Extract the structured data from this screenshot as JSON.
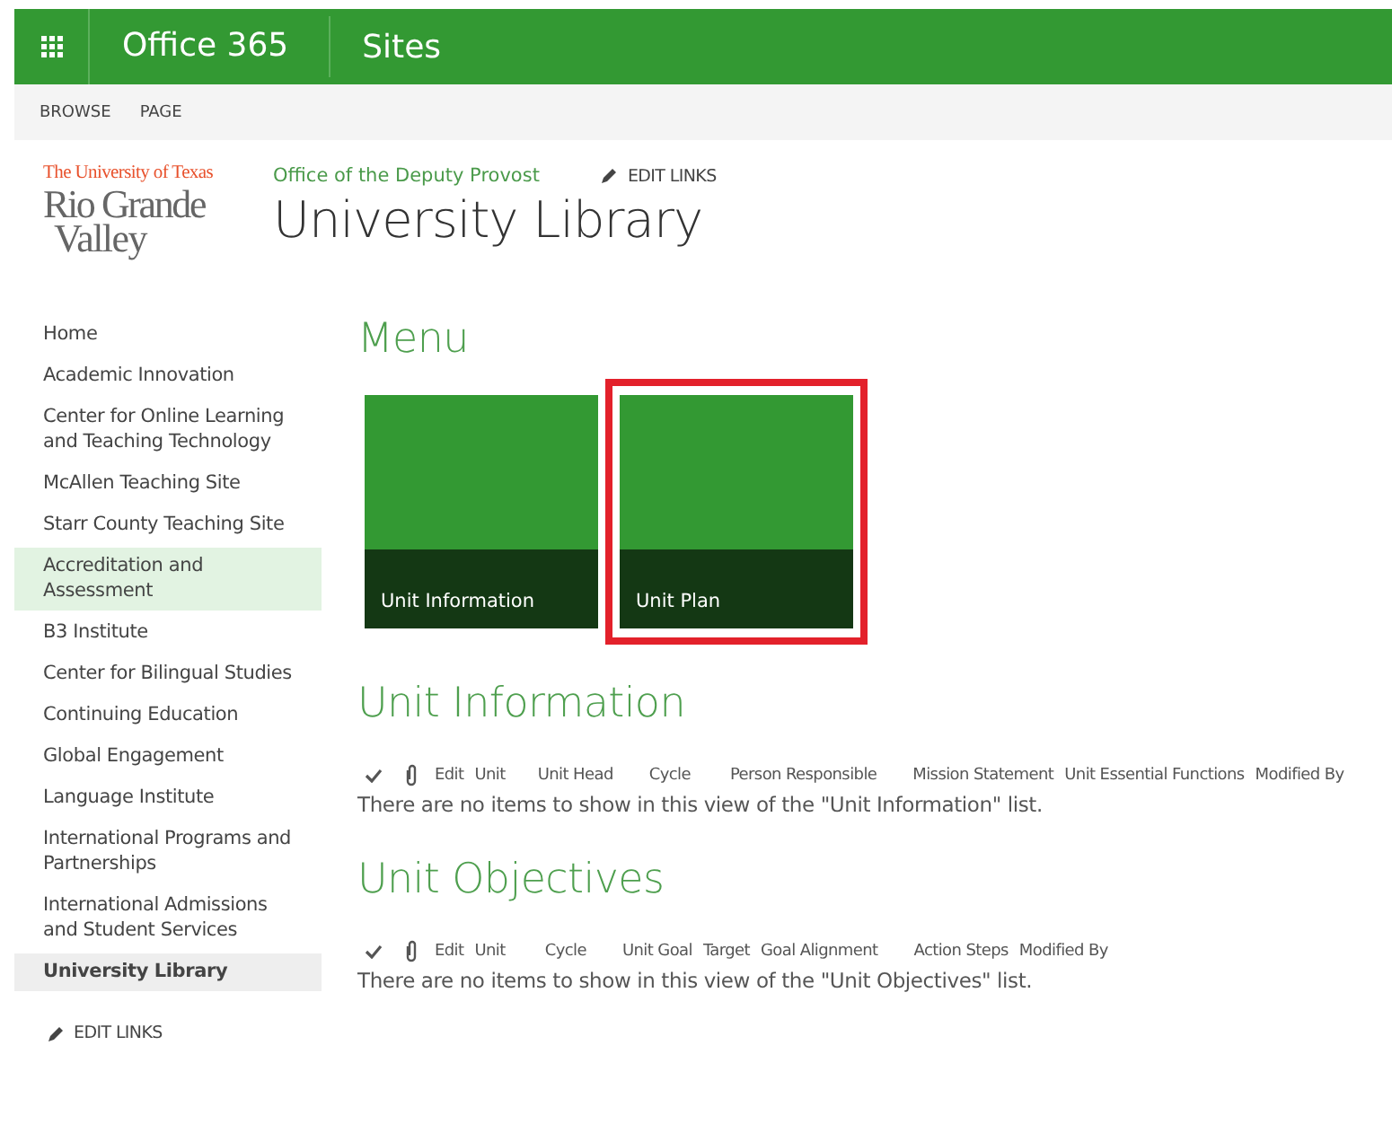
{
  "suite_bar": {
    "app_name": "Office 365",
    "section": "Sites"
  },
  "ribbon_tabs": [
    {
      "label": "BROWSE",
      "selected": false
    },
    {
      "label": "PAGE",
      "selected": false
    }
  ],
  "logo": {
    "line_1": "The University of Texas",
    "line_2": "Rio Grande",
    "line_3": "Valley"
  },
  "breadcrumb": "Office of the Deputy Provost",
  "top_edit_links": "EDIT LINKS",
  "site_title": "University Library",
  "sidebar": {
    "items": [
      {
        "label": "Home",
        "selected": false,
        "hovered": false
      },
      {
        "label": "Academic Innovation",
        "selected": false,
        "hovered": false
      },
      {
        "label": "Center for Online Learning and Teaching Technology",
        "selected": false,
        "hovered": false
      },
      {
        "label": "McAllen Teaching Site",
        "selected": false,
        "hovered": false
      },
      {
        "label": "Starr County Teaching Site",
        "selected": false,
        "hovered": false
      },
      {
        "label": "Accreditation and Assessment",
        "selected": false,
        "hovered": true
      },
      {
        "label": "B3 Institute",
        "selected": false,
        "hovered": false
      },
      {
        "label": "Center for Bilingual Studies",
        "selected": false,
        "hovered": false
      },
      {
        "label": "Continuing Education",
        "selected": false,
        "hovered": false
      },
      {
        "label": "Global Engagement",
        "selected": false,
        "hovered": false
      },
      {
        "label": "Language Institute",
        "selected": false,
        "hovered": false
      },
      {
        "label": "International Programs and Partnerships",
        "selected": false,
        "hovered": false
      },
      {
        "label": "International Admissions and Student Services",
        "selected": false,
        "hovered": false
      },
      {
        "label": "University Library",
        "selected": true,
        "hovered": false
      }
    ],
    "edit_links": "EDIT LINKS"
  },
  "menu": {
    "heading": "Menu",
    "tiles": [
      {
        "label": "Unit Information",
        "highlighted": false
      },
      {
        "label": "Unit Plan",
        "highlighted": true
      }
    ]
  },
  "lists": [
    {
      "heading": "Unit Information",
      "columns": [
        "Edit",
        "Unit",
        "Unit Head",
        "Cycle",
        "Person Responsible",
        "Mission Statement",
        "Unit Essential Functions",
        "Modified By"
      ],
      "empty_message": "There are no items to show in this view of the \"Unit Information\" list."
    },
    {
      "heading": "Unit Objectives",
      "columns": [
        "Edit",
        "Unit",
        "Cycle",
        "Unit Goal",
        "Target",
        "Goal Alignment",
        "Action Steps",
        "Modified By"
      ],
      "empty_message": "There are no items to show in this view of the \"Unit Objectives\" list."
    }
  ]
}
